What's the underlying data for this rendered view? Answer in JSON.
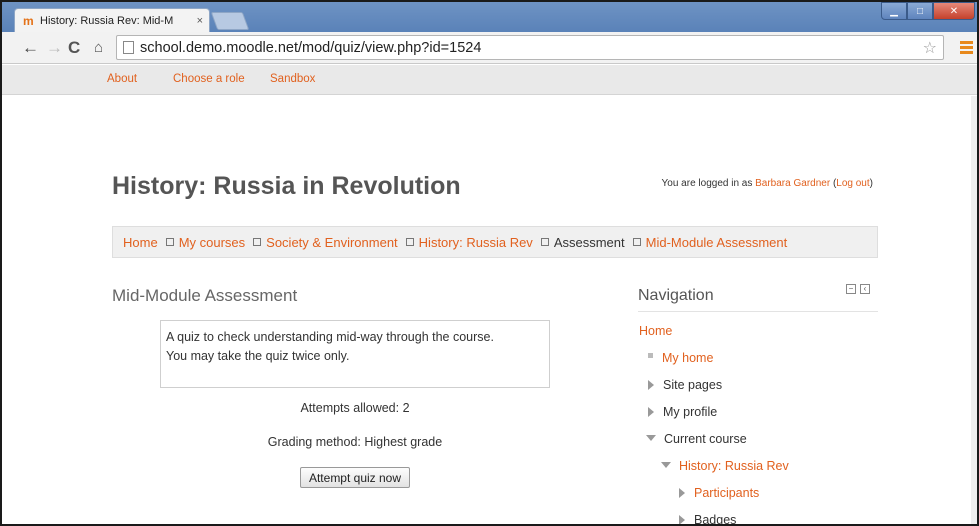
{
  "browser": {
    "tab_title": "History: Russia Rev: Mid-M",
    "tab_close": "×",
    "url": "school.demo.moodle.net/mod/quiz/view.php?id=1524"
  },
  "topmenu": {
    "items": [
      "About",
      "Choose a role",
      "Sandbox"
    ]
  },
  "header": {
    "course_title": "History: Russia in Revolution",
    "login_prefix": "You are logged in as ",
    "user_name": "Barbara Gardner",
    "logout_open": " (",
    "logout_label": "Log out",
    "logout_close": ")"
  },
  "breadcrumb": {
    "items": [
      {
        "label": "Home",
        "link": true
      },
      {
        "label": "My courses",
        "link": true
      },
      {
        "label": "Society & Environment",
        "link": true
      },
      {
        "label": "History: Russia Rev",
        "link": true
      },
      {
        "label": "Assessment",
        "link": false
      },
      {
        "label": "Mid-Module Assessment",
        "link": true
      }
    ]
  },
  "main": {
    "activity_title": "Mid-Module Assessment",
    "intro_line1": "A quiz to check understanding mid-way through the course.",
    "intro_line2": "You may take the quiz twice only.",
    "attempts_allowed": "Attempts allowed: 2",
    "grading_method": "Grading method: Highest grade",
    "attempt_button": "Attempt quiz now"
  },
  "navigation": {
    "title": "Navigation",
    "items": [
      {
        "label": "Home",
        "link": true,
        "marker": "none",
        "indent": 0
      },
      {
        "label": "My home",
        "link": true,
        "marker": "bullet",
        "indent": 1
      },
      {
        "label": "Site pages",
        "link": false,
        "marker": "collapsed",
        "indent": 1
      },
      {
        "label": "My profile",
        "link": false,
        "marker": "collapsed",
        "indent": 1
      },
      {
        "label": "Current course",
        "link": false,
        "marker": "expanded",
        "indent": 1
      },
      {
        "label": "History: Russia Rev",
        "link": true,
        "marker": "expanded",
        "indent": 2
      },
      {
        "label": "Participants",
        "link": true,
        "marker": "collapsed",
        "indent": 3
      },
      {
        "label": "Badges",
        "link": false,
        "marker": "collapsed",
        "indent": 3
      }
    ]
  },
  "colors": {
    "link": "#e1611f",
    "breadcrumb_bg": "#f0f0f0",
    "chrome_titlebar": "#5a82b8"
  }
}
